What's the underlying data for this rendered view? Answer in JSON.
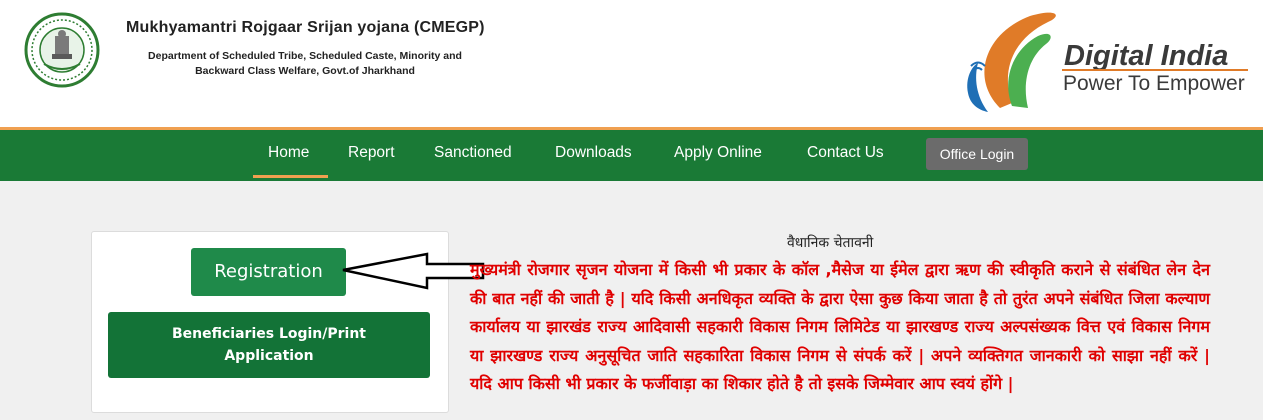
{
  "header": {
    "title": "Mukhyamantri Rojgaar Srijan yojana (CMEGP)",
    "dept_line1": "Department of Scheduled Tribe, Scheduled Caste, Minority and",
    "dept_line2": "Backward Class Welfare, Govt.of Jharkhand",
    "emblem_icon": "jharkhand-emblem-icon",
    "logo_title": "Digital India",
    "logo_subtitle": "Power To Empower"
  },
  "nav": {
    "items": [
      {
        "label": "Home"
      },
      {
        "label": "Report"
      },
      {
        "label": "Sanctioned"
      },
      {
        "label": "Downloads"
      },
      {
        "label": "Apply Online"
      },
      {
        "label": "Contact Us"
      }
    ],
    "active": "Home",
    "office_login": "Office Login"
  },
  "left_panel": {
    "registration_label": "Registration",
    "beneficiaries_label": "Beneficiaries Login/Print Application"
  },
  "notice": {
    "heading": "वैधानिक चेतावनी",
    "body": "मुख्यमंत्री रोजगार सृजन योजना में किसी भी प्रकार के कॉल ,मैसेज या ईमेल द्वारा ऋण की स्वीकृति कराने से संबंधित लेन देन की बात नहीं की जाती है | यदि किसी अनधिकृत व्यक्ति के द्वारा ऐसा कुछ किया जाता है तो तुरंत अपने संबंधित जिला कल्याण कार्यालय या झारखंड राज्य आदिवासी सहकारी विकास निगम लिमिटेड या झारखण्ड राज्य अल्पसंख्यक वित्त एवं विकास निगम या झारखण्ड राज्य अनुसूचित जाति सहकारिता विकास निगम से संपर्क करें | अपने व्यक्तिगत जानकारी को साझा नहीं करें | यदि आप किसी भी प्रकार के फर्जीवाड़ा का शिकार होते है तो इसके जिम्मेवार आप स्वयं होंगे |"
  },
  "colors": {
    "nav_green": "#1a7a36",
    "accent_orange": "#f0a050",
    "notice_red": "#e00000",
    "button_green": "#1f8a4a"
  }
}
